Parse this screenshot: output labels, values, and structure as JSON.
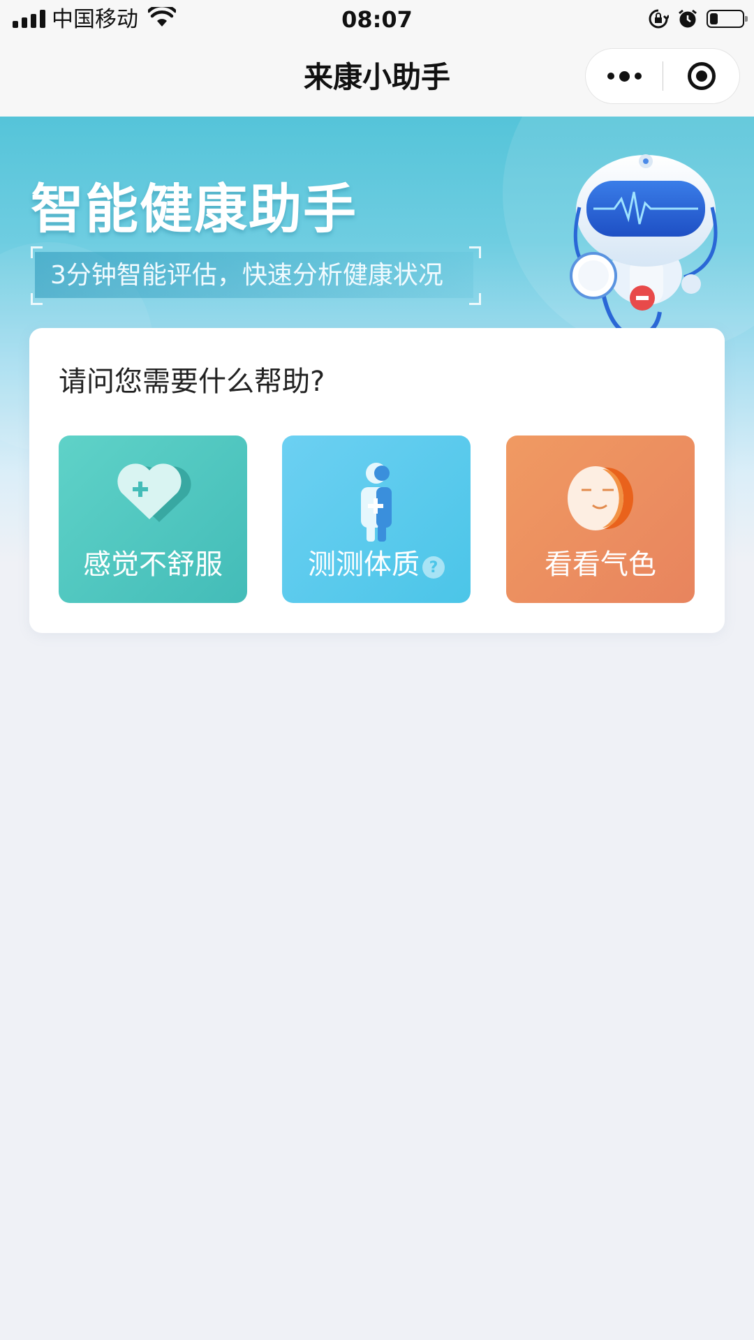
{
  "status_bar": {
    "carrier": "中国移动",
    "time": "08:07",
    "icons": [
      "signal-icon",
      "wifi-icon",
      "rotation-lock-icon",
      "alarm-icon",
      "battery-icon"
    ],
    "battery_level": 0.25
  },
  "nav": {
    "title": "来康小助手",
    "more_icon": "more-dots-icon",
    "close_icon": "close-target-icon"
  },
  "banner": {
    "title": "智能健康助手",
    "subtitle": "3分钟智能评估，快速分析健康状况",
    "illustration": "doctor-robot-icon"
  },
  "card": {
    "question": "请问您需要什么帮助?",
    "options": [
      {
        "label": "感觉不舒服",
        "icon": "heart-plus-icon",
        "color": "#4ec4bd"
      },
      {
        "label": "测测体质",
        "icon": "person-plus-icon",
        "color": "#55c8ec",
        "help": "?"
      },
      {
        "label": "看看气色",
        "icon": "face-icon",
        "color": "#ec8d5f"
      }
    ]
  },
  "colors": {
    "banner": "#55c4d9",
    "page_background": "#eff1f6"
  }
}
